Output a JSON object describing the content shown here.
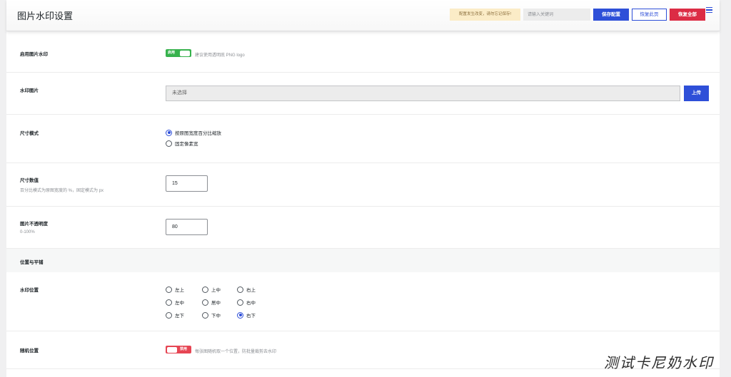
{
  "header": {
    "title": "图片水印设置",
    "notice": "配置发生改变，请勿忘记保存!",
    "search_placeholder": "请输入关键词",
    "save_label": "保存配置",
    "restore_label": "恢复此页",
    "reset_label": "恢复全部",
    "menu_icon": "hamburger-menu-icon"
  },
  "colors": {
    "primary": "#2e4fd8",
    "danger": "#dc2c45",
    "success": "#37b24d",
    "notice_bg": "#fbecc7"
  },
  "enable_watermark": {
    "label": "启用图片水印",
    "switch_text": "启用",
    "state": "on",
    "help": "建议使用透明底 PNG logo"
  },
  "watermark_image": {
    "label": "水印图片",
    "value": "未选择",
    "upload_label": "上传"
  },
  "size_mode": {
    "label": "尺寸模式",
    "options": [
      "按原图宽度百分比缩放",
      "固定像素宽"
    ],
    "selected": "按原图宽度百分比缩放"
  },
  "size_value": {
    "label": "尺寸数值",
    "desc": "百分比模式为原图宽度的 %，固定模式为 px",
    "value": "15"
  },
  "opacity": {
    "label": "图片不透明度",
    "desc": "0-100%",
    "value": "80"
  },
  "section": {
    "title": "位置与平铺"
  },
  "position": {
    "label": "水印位置",
    "options": [
      "左上",
      "上中",
      "右上",
      "左中",
      "居中",
      "右中",
      "左下",
      "下中",
      "右下"
    ],
    "selected": "右下"
  },
  "random_position": {
    "label": "随机位置",
    "switch_text": "禁用",
    "state": "off",
    "help": "每张图随机取一个位置，防批量裁剪去水印"
  },
  "overlay_watermark": "测试卡尼奶水印"
}
